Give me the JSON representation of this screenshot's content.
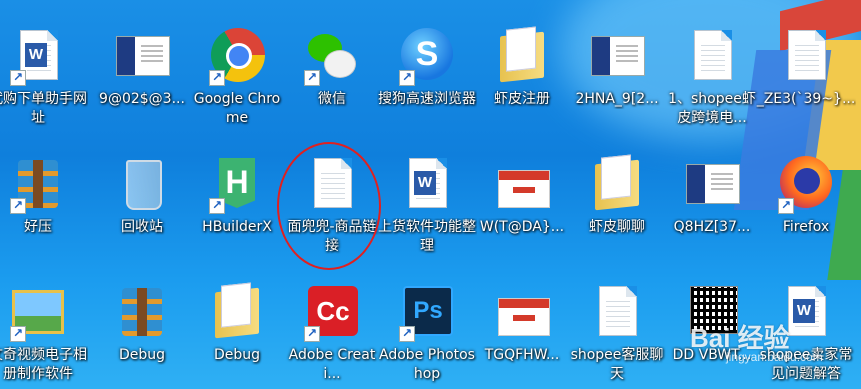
{
  "desktop": {
    "icons": [
      {
        "label": "代购下单助手网址",
        "icon": "word-document-icon"
      },
      {
        "label": "9@02$@3...",
        "icon": "installer-screenshot-icon"
      },
      {
        "label": "Google Chrome",
        "icon": "chrome-icon"
      },
      {
        "label": "微信",
        "icon": "wechat-icon"
      },
      {
        "label": "搜狗高速浏览器",
        "icon": "sogou-browser-icon"
      },
      {
        "label": "虾皮注册",
        "icon": "folder-icon"
      },
      {
        "label": "2HNA_9[2...",
        "icon": "installer-screenshot-icon"
      },
      {
        "label": "1、shopee虾皮跨境电...",
        "icon": "text-document-icon"
      },
      {
        "label": "_ZE3(`39~}...",
        "icon": "text-document-icon"
      },
      {
        "label": "好压",
        "icon": "archive-icon"
      },
      {
        "label": "回收站",
        "icon": "recycle-bin-icon"
      },
      {
        "label": "HBuilderX",
        "icon": "hbuilderx-icon"
      },
      {
        "label": "面兜兜-商品链接",
        "icon": "text-document-icon"
      },
      {
        "label": "上货软件功能整理",
        "icon": "word-document-icon"
      },
      {
        "label": "W(T@DA}...",
        "icon": "webpage-screenshot-icon"
      },
      {
        "label": "虾皮聊聊",
        "icon": "folder-icon"
      },
      {
        "label": "Q8HZ[37...",
        "icon": "installer-screenshot-icon"
      },
      {
        "label": "Firefox",
        "icon": "firefox-icon"
      },
      {
        "label": "文奇视频电子相册制作软件",
        "icon": "picture-icon"
      },
      {
        "label": "Debug",
        "icon": "archive-icon"
      },
      {
        "label": "Debug",
        "icon": "folder-icon"
      },
      {
        "label": "Adobe Creati...",
        "icon": "adobe-creative-cloud-icon"
      },
      {
        "label": "Adobe Photoshop",
        "icon": "photoshop-icon"
      },
      {
        "label": "TGQFHW...",
        "icon": "webpage-screenshot-icon"
      },
      {
        "label": "shopee客服聊天",
        "icon": "text-document-icon"
      },
      {
        "label": "DD VBWT...",
        "icon": "qr-code-icon"
      },
      {
        "label": "shopee卖家常见问题解答",
        "icon": "word-document-icon"
      }
    ],
    "watermark": "Bai 经验",
    "watermark_sub": "jingyan.baidu.com",
    "annotation_color": "#e02020"
  }
}
